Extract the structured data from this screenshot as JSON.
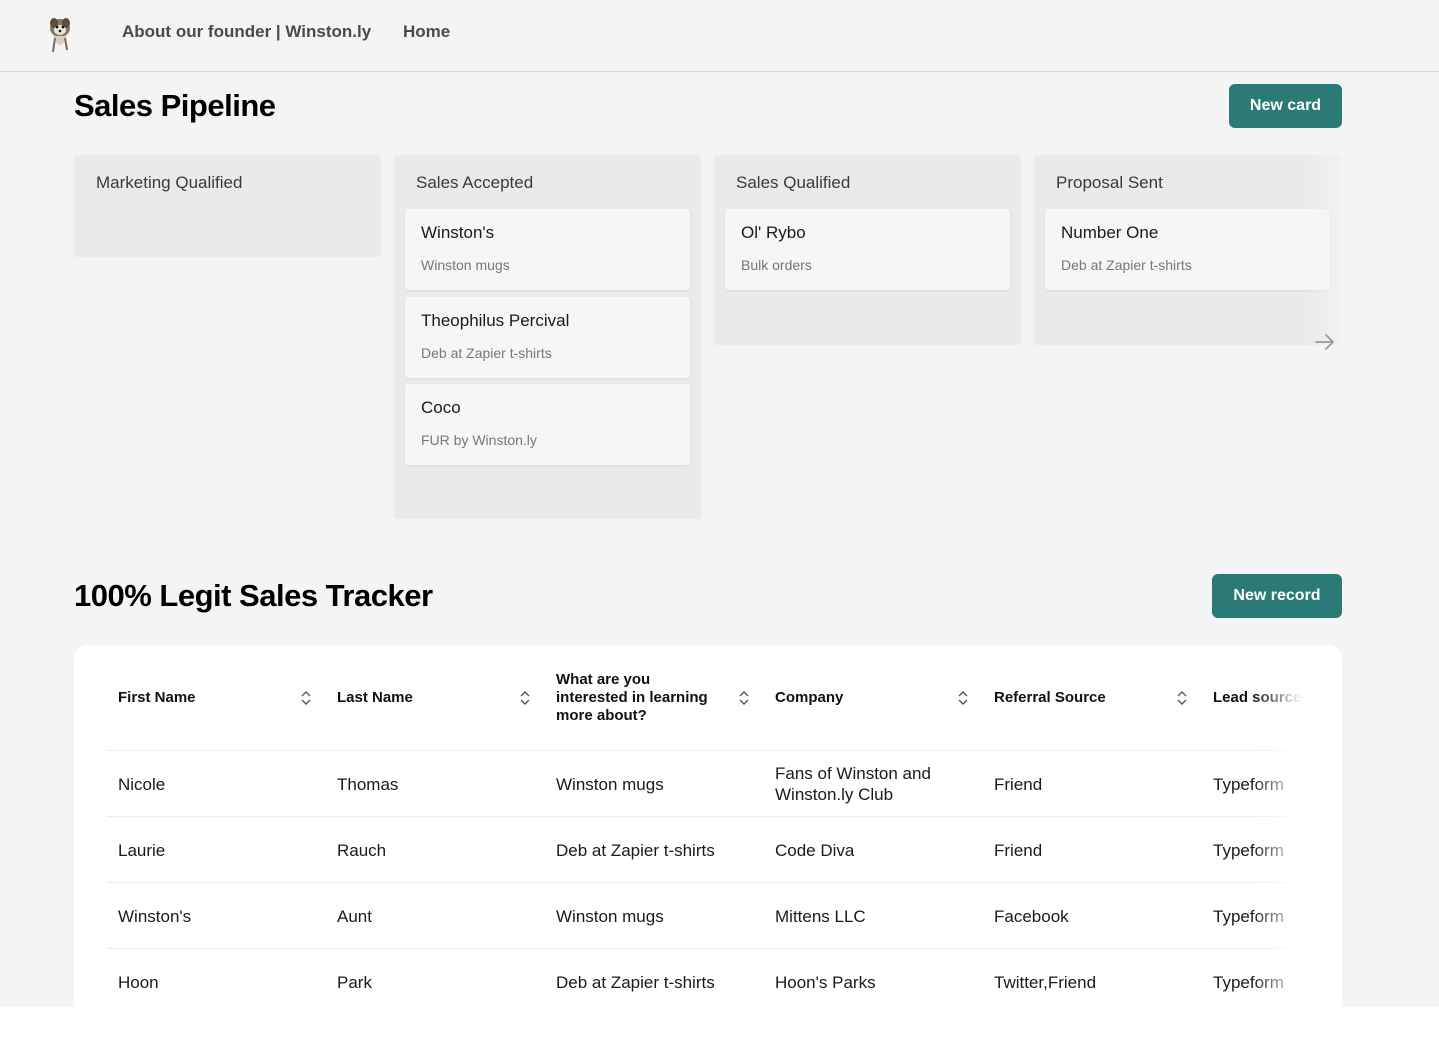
{
  "nav": {
    "about_label": "About our founder | Winston.ly",
    "home_label": "Home"
  },
  "pipeline": {
    "title": "Sales Pipeline",
    "new_button": "New card",
    "columns": [
      {
        "title": "Marketing Qualified",
        "cards": []
      },
      {
        "title": "Sales Accepted",
        "cards": [
          {
            "title": "Winston's",
            "subtitle": "Winston mugs"
          },
          {
            "title": "Theophilus Percival",
            "subtitle": "Deb at Zapier t-shirts"
          },
          {
            "title": "Coco",
            "subtitle": "FUR by Winston.ly"
          }
        ]
      },
      {
        "title": "Sales Qualified",
        "cards": [
          {
            "title": "Ol' Rybo",
            "subtitle": "Bulk orders"
          }
        ]
      },
      {
        "title": "Proposal Sent",
        "cards": [
          {
            "title": "Number One",
            "subtitle": "Deb at Zapier t-shirts"
          }
        ]
      }
    ]
  },
  "tracker": {
    "title": "100% Legit Sales Tracker",
    "new_button": "New record",
    "columns": [
      "First Name",
      "Last Name",
      "What are you interested in learning more about?",
      "Company",
      "Referral Source",
      "Lead source"
    ],
    "rows": [
      [
        "Nicole",
        "Thomas",
        "Winston mugs",
        "Fans of Winston and Winston.ly Club",
        "Friend",
        "Typeform"
      ],
      [
        "Laurie",
        "Rauch",
        "Deb at Zapier t-shirts",
        "Code Diva",
        "Friend",
        "Typeform"
      ],
      [
        "Winston's",
        "Aunt",
        "Winston mugs",
        "Mittens LLC",
        "Facebook",
        "Typeform"
      ],
      [
        "Hoon",
        "Park",
        "Deb at Zapier t-shirts",
        "Hoon's Parks",
        "Twitter,Friend",
        "Typeform"
      ]
    ]
  },
  "colors": {
    "accent": "#2a7b76",
    "background": "#f4f4f4",
    "column_bg": "#eaeaea"
  },
  "icons": {
    "logo": "dog-logo-icon",
    "sort": "sort-icon",
    "scroll_right": "arrow-right-icon"
  }
}
